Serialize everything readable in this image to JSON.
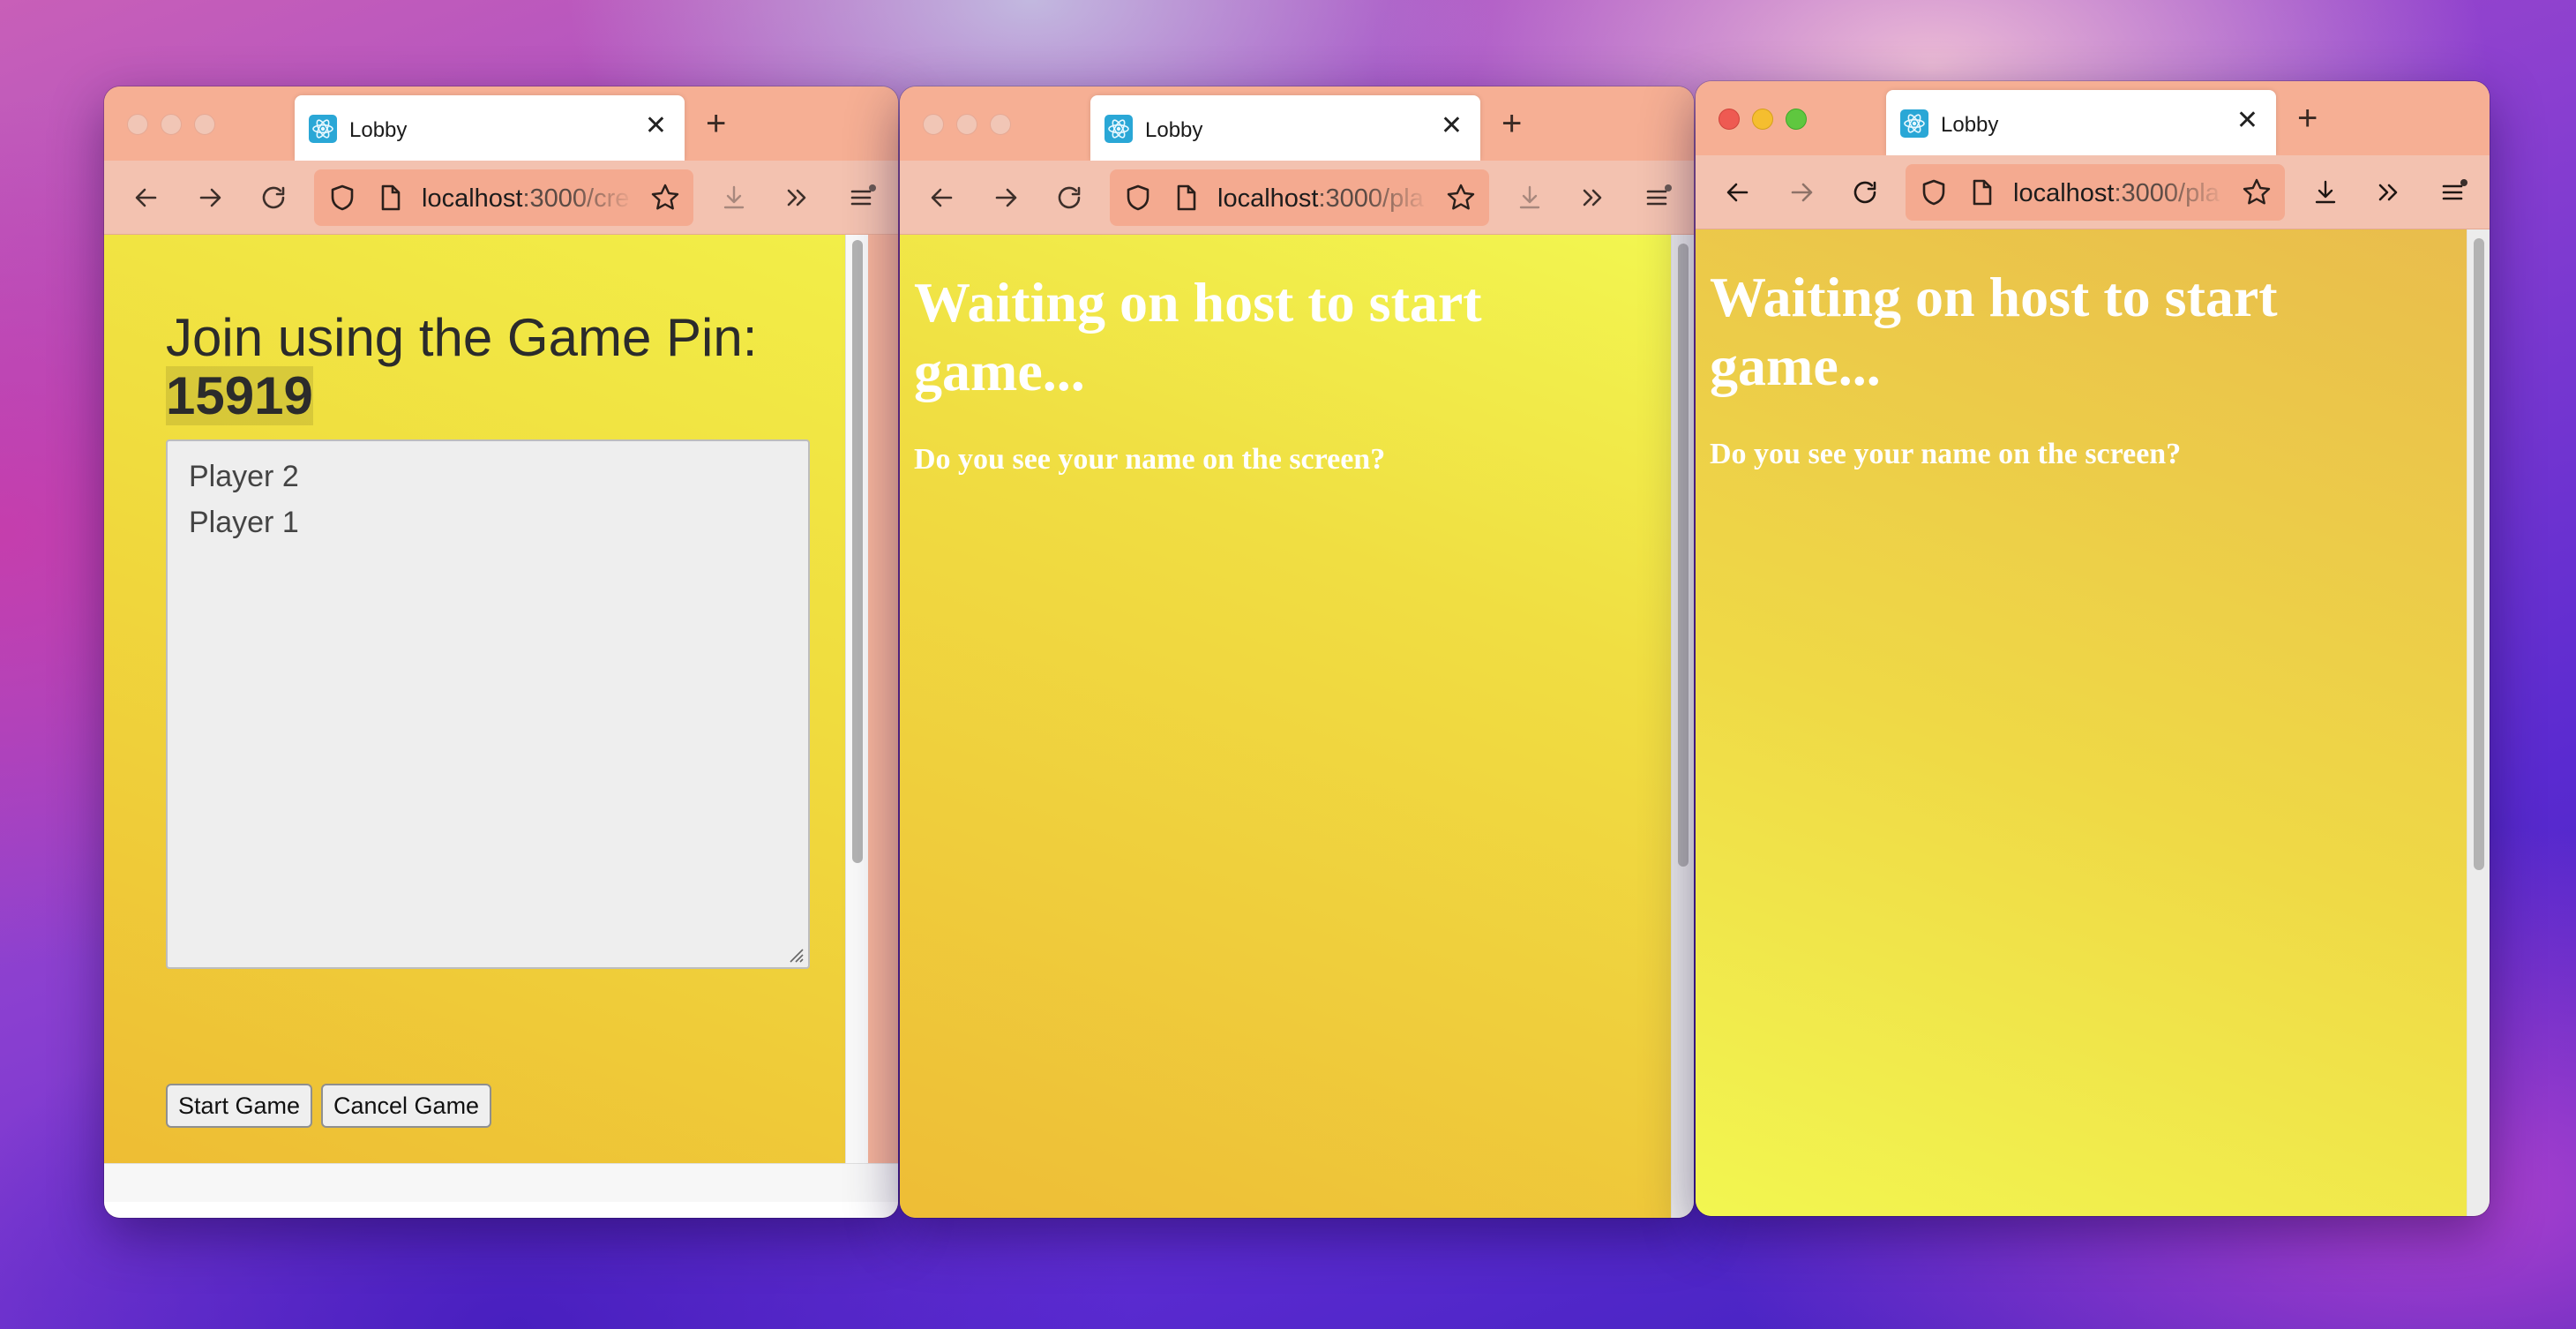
{
  "windows": [
    {
      "tab_title": "Lobby",
      "url_host": "localhost",
      "url_rest": ":3000/cre",
      "page": {
        "heading_prefix": "Join using the Game Pin:",
        "game_pin": "15919",
        "players": [
          "Player 2",
          "Player 1"
        ],
        "start_button": "Start Game",
        "cancel_button": "Cancel Game"
      }
    },
    {
      "tab_title": "Lobby",
      "url_host": "localhost",
      "url_rest": ":3000/pla",
      "page": {
        "heading_line1": "Waiting on host to start",
        "heading_line2": "game...",
        "subtext": "Do you see your name on the screen?"
      }
    },
    {
      "tab_title": "Lobby",
      "url_host": "localhost",
      "url_rest": ":3000/pla",
      "page": {
        "heading_line1": "Waiting on host to start",
        "heading_line2": "game...",
        "subtext": "Do you see your name on the screen?"
      }
    }
  ],
  "colors": {
    "tab_strip": "#f6af94",
    "toolbar": "#f3c2b0",
    "page_yellow": "#f2ee48",
    "page_orange": "#eebd34",
    "heading_white": "#ffffff"
  },
  "icons": [
    "react-favicon",
    "close-icon",
    "plus-icon",
    "back-arrow-icon",
    "forward-arrow-icon",
    "reload-icon",
    "shield-icon",
    "page-icon",
    "star-icon",
    "download-icon",
    "chevron-double-right-icon",
    "hamburger-menu-icon"
  ]
}
